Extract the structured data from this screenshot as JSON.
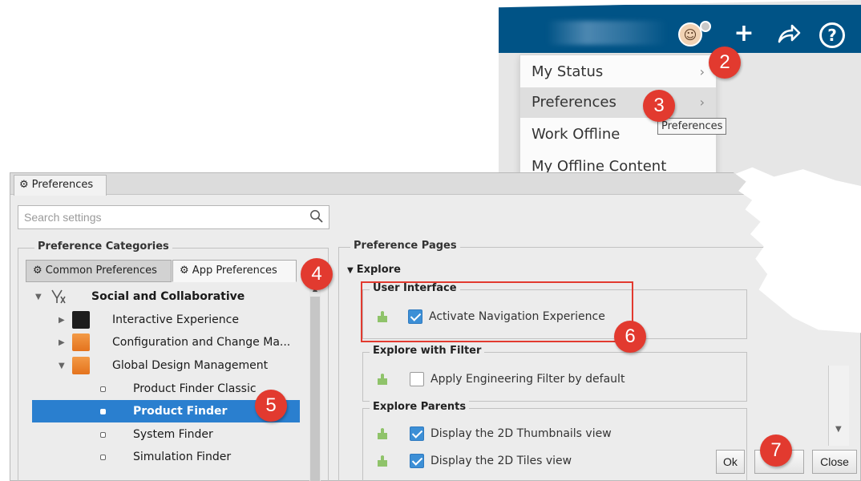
{
  "header": {
    "menu_items": [
      {
        "label": "My Status"
      },
      {
        "label": "Preferences"
      },
      {
        "label": "Work Offline"
      },
      {
        "label": "My Offline Content"
      }
    ],
    "tooltip": "Preferences",
    "chevron": "›",
    "plus_glyph": "+",
    "help_glyph": "?",
    "icons": [
      "avatar-icon",
      "plus-icon",
      "share-icon",
      "help-icon"
    ]
  },
  "dialog": {
    "tab_title": "Preferences",
    "gear_glyph": "⚙",
    "search": {
      "placeholder": "Search settings"
    },
    "categories": {
      "legend": "Preference Categories",
      "tabs": [
        "Common Preferences",
        "App Preferences"
      ],
      "tree": [
        {
          "label": "Social and Collaborative",
          "level": 0,
          "bold": true
        },
        {
          "label": "Interactive Experience",
          "level": 1,
          "icon": "black-app-icon"
        },
        {
          "label": "Configuration and Change Ma...",
          "level": 1,
          "icon": "orange-app-icon"
        },
        {
          "label": "Global Design Management",
          "level": 1,
          "icon": "orange-app-icon"
        },
        {
          "label": "Product Finder Classic",
          "level": 2
        },
        {
          "label": "Product Finder",
          "level": 2,
          "selected": true
        },
        {
          "label": "System Finder",
          "level": 2
        },
        {
          "label": "Simulation Finder",
          "level": 2
        }
      ]
    },
    "pages": {
      "legend": "Preference Pages",
      "explore_label": "Explore",
      "groups": [
        {
          "legend": "User Interface",
          "items": [
            {
              "label": "Activate Navigation Experience",
              "checked": true
            }
          ]
        },
        {
          "legend": "Explore with Filter",
          "items": [
            {
              "label": "Apply Engineering Filter by default",
              "checked": false
            }
          ]
        },
        {
          "legend": "Explore Parents",
          "items": [
            {
              "label": "Display the 2D Thumbnails view",
              "checked": true
            },
            {
              "label": "Display the 2D Tiles view",
              "checked": true
            }
          ]
        }
      ]
    },
    "buttons": {
      "ok": "Ok",
      "apply": "",
      "close": "Close"
    }
  },
  "callouts": [
    "2",
    "3",
    "4",
    "5",
    "6",
    "7"
  ],
  "colors": {
    "header_blue": "#005386",
    "selection_blue": "#2a7fcf",
    "callout_red": "#e23a2f",
    "checkbox_blue": "#3c8fd6"
  }
}
